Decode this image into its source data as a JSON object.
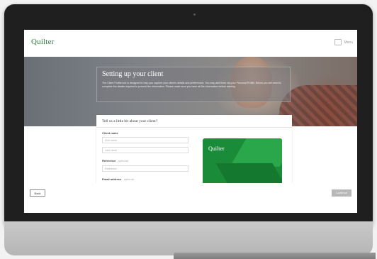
{
  "app": {
    "logo": "Quilter",
    "help_label": "Menu"
  },
  "hero": {
    "title": "Setting up your client",
    "text": "The Client Profile tool is designed to help you capture your client's details and preferences. You may add them via your Personal Profile. Below you will need to complete the details required to present the information. Please make sure you have all the information before starting."
  },
  "form": {
    "title": "Tell us a little bit about your client?",
    "client_name_label": "Client name",
    "first_name_placeholder": "First name",
    "last_name_placeholder": "Last name",
    "reference_label": "Reference",
    "reference_optional": "- optional",
    "reference_placeholder": "Reference",
    "email_label": "Email address",
    "email_optional": "- optional"
  },
  "card": {
    "logo": "Quilter"
  },
  "footer": {
    "back_label": "Back",
    "continue_label": "Continue"
  }
}
